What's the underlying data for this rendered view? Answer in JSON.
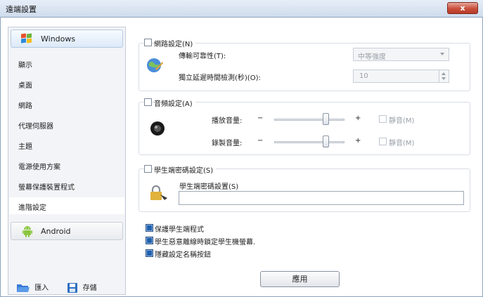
{
  "window": {
    "title": "遠端設置",
    "close_glyph": "x"
  },
  "sidebar": {
    "windows_header": {
      "label": "Windows",
      "icon": "windows-logo-icon"
    },
    "items": [
      {
        "label": "顯示"
      },
      {
        "label": "桌面"
      },
      {
        "label": "網路"
      },
      {
        "label": "代理伺服器"
      },
      {
        "label": "主題"
      },
      {
        "label": "電源使用方案"
      },
      {
        "label": "螢幕保護裝置程式"
      },
      {
        "label": "進階設定",
        "selected": true
      }
    ],
    "android_header": {
      "label": "Android",
      "icon": "android-logo-icon"
    },
    "footer": {
      "import_label": "匯入",
      "save_label": "存儲"
    }
  },
  "network": {
    "label": "網路設定(N)",
    "checked": false,
    "reliability_label": "傳輸可靠性(T):",
    "reliability_value": "中等強度",
    "latency_label": "獨立延遲時間檢測(秒)(O):",
    "latency_value": "10"
  },
  "audio": {
    "label": "音頻設定(A)",
    "checked": false,
    "playback_label": "播放音量:",
    "record_label": "錄製音量:",
    "minus": "−",
    "plus": "+",
    "mute_label": "靜音(M)",
    "playback_level": 0.73,
    "record_level": 0.73
  },
  "password": {
    "label": "學生端密碼設定(S)",
    "checked": false,
    "field_label": "學生端密碼設置(S)",
    "value": ""
  },
  "options": [
    {
      "label": "保護學生端程式",
      "checked": true
    },
    {
      "label": "學生惡意離線時鎖定學生機螢幕.",
      "checked": true
    },
    {
      "label": "隱藏設定名稱按鈕",
      "checked": true
    }
  ],
  "apply_label": "應用",
  "colors": {
    "accent": "#1f5fae",
    "titlebar": "#dbe6f3",
    "close": "#c9503d"
  }
}
